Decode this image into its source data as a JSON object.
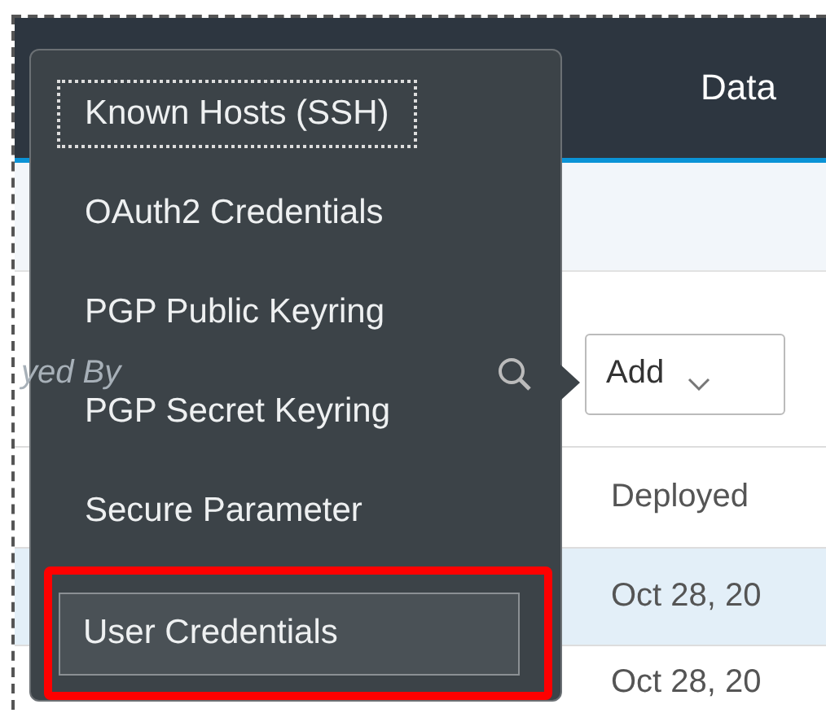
{
  "header": {
    "title": "Data"
  },
  "search": {
    "placeholder": "yed By"
  },
  "add_button": {
    "label": "Add"
  },
  "table": {
    "columns": [
      "Deployed"
    ],
    "rows": [
      {
        "cells": [
          "Oct 28, 20"
        ],
        "selected": true
      },
      {
        "cells": [
          "Oct 28, 20"
        ],
        "selected": false
      }
    ]
  },
  "menu": {
    "items": [
      {
        "label": "Known Hosts (SSH)",
        "focused": true,
        "hovered": false,
        "annotated": false
      },
      {
        "label": "OAuth2 Credentials",
        "focused": false,
        "hovered": false,
        "annotated": false
      },
      {
        "label": "PGP Public Keyring",
        "focused": false,
        "hovered": false,
        "annotated": false
      },
      {
        "label": "PGP Secret Keyring",
        "focused": false,
        "hovered": false,
        "annotated": false
      },
      {
        "label": "Secure Parameter",
        "focused": false,
        "hovered": false,
        "annotated": false
      },
      {
        "label": "User Credentials",
        "focused": false,
        "hovered": true,
        "annotated": true
      }
    ]
  }
}
